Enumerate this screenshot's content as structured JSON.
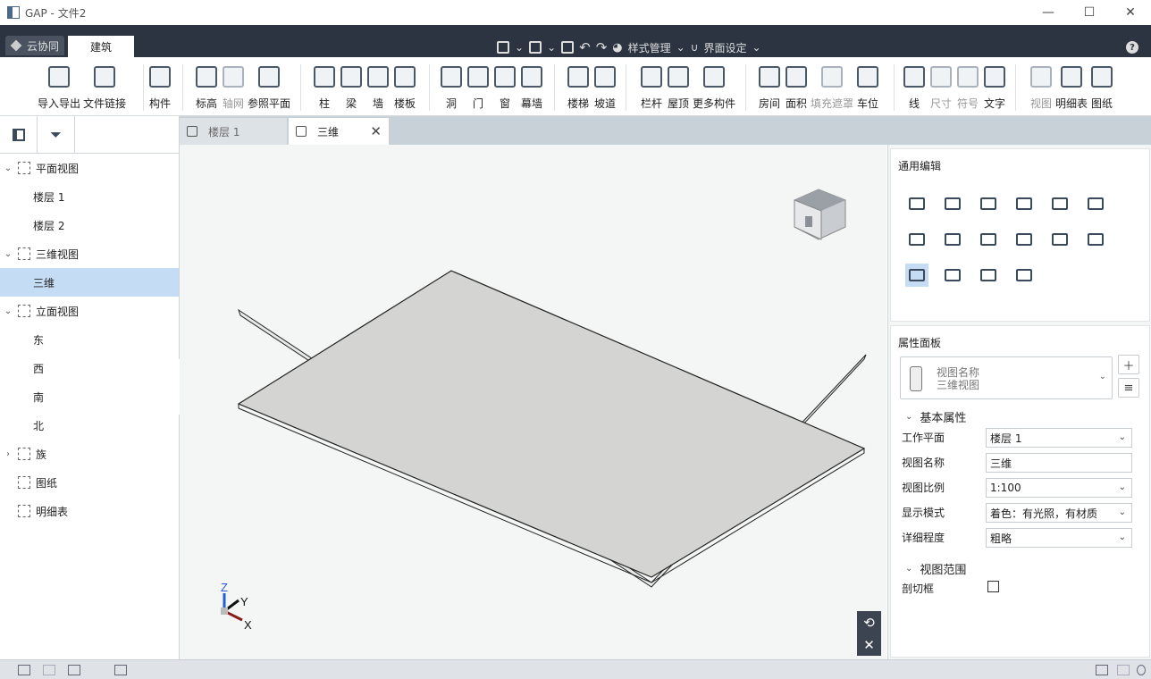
{
  "window": {
    "title": "GAP - 文件2",
    "minimize": "—",
    "maximize": "☐",
    "close": "✕"
  },
  "tabs": {
    "cloud": "云协同",
    "build": "建筑"
  },
  "quickbar": {
    "style_manage": "样式管理",
    "ui_settings": "界面设定",
    "help": "?"
  },
  "ribbon": [
    {
      "label": "导入导出",
      "icon": "cad-import-icon",
      "enabled": true
    },
    {
      "label": "文件链接",
      "icon": "file-link-icon",
      "enabled": true
    },
    {
      "label": "构件",
      "icon": "component-icon",
      "enabled": true
    },
    {
      "label": "标高",
      "icon": "level-icon",
      "enabled": true
    },
    {
      "label": "轴网",
      "icon": "grid-icon",
      "enabled": false
    },
    {
      "label": "参照平面",
      "icon": "ref-plane-icon",
      "enabled": true
    },
    {
      "label": "柱",
      "icon": "column-icon",
      "enabled": true
    },
    {
      "label": "梁",
      "icon": "beam-icon",
      "enabled": true
    },
    {
      "label": "墙",
      "icon": "wall-icon",
      "enabled": true
    },
    {
      "label": "楼板",
      "icon": "slab-icon",
      "enabled": true
    },
    {
      "label": "洞",
      "icon": "opening-icon",
      "enabled": true
    },
    {
      "label": "门",
      "icon": "door-icon",
      "enabled": true
    },
    {
      "label": "窗",
      "icon": "window-icon",
      "enabled": true
    },
    {
      "label": "幕墙",
      "icon": "curtain-wall-icon",
      "enabled": true
    },
    {
      "label": "楼梯",
      "icon": "stair-icon",
      "enabled": true
    },
    {
      "label": "坡道",
      "icon": "ramp-icon",
      "enabled": true
    },
    {
      "label": "栏杆",
      "icon": "railing-icon",
      "enabled": true
    },
    {
      "label": "屋顶",
      "icon": "roof-icon",
      "enabled": true
    },
    {
      "label": "更多构件",
      "icon": "more-components-icon",
      "enabled": true
    },
    {
      "label": "房间",
      "icon": "room-icon",
      "enabled": true
    },
    {
      "label": "面积",
      "icon": "area-icon",
      "enabled": true
    },
    {
      "label": "填充遮罩",
      "icon": "fill-mask-icon",
      "enabled": false
    },
    {
      "label": "车位",
      "icon": "parking-icon",
      "enabled": true
    },
    {
      "label": "线",
      "icon": "line-icon",
      "enabled": true
    },
    {
      "label": "尺寸",
      "icon": "dimension-icon",
      "enabled": false
    },
    {
      "label": "符号",
      "icon": "symbol-icon",
      "enabled": false
    },
    {
      "label": "文字",
      "icon": "text-icon",
      "enabled": true
    },
    {
      "label": "视图",
      "icon": "view-icon",
      "enabled": false
    },
    {
      "label": "明细表",
      "icon": "schedule-icon",
      "enabled": true
    },
    {
      "label": "图纸",
      "icon": "sheet-icon",
      "enabled": true
    }
  ],
  "tree": [
    {
      "label": "平面视图",
      "expanded": true
    },
    {
      "label": "楼层 1"
    },
    {
      "label": "楼层 2"
    },
    {
      "label": "三维视图",
      "expanded": true
    },
    {
      "label": "三维",
      "selected": true
    },
    {
      "label": "立面视图",
      "expanded": true
    },
    {
      "label": "东"
    },
    {
      "label": "西"
    },
    {
      "label": "南"
    },
    {
      "label": "北"
    },
    {
      "label": "族",
      "expanded": false
    },
    {
      "label": "图纸"
    },
    {
      "label": "明细表"
    }
  ],
  "doctabs": [
    {
      "label": "楼层 1"
    },
    {
      "label": "三维",
      "active": true
    }
  ],
  "axes": {
    "z": "Z",
    "y": "Y",
    "x": "X"
  },
  "general_edit": {
    "title": "通用编辑"
  },
  "properties": {
    "title": "属性面板",
    "type_name_label": "视图名称",
    "type_name_value": "三维视图",
    "basic_section": "基本属性",
    "rows": [
      {
        "label": "工作平面",
        "value": "楼层 1",
        "dropdown": true
      },
      {
        "label": "视图名称",
        "value": "三维",
        "dropdown": false
      },
      {
        "label": "视图比例",
        "value": "1:100",
        "dropdown": true
      },
      {
        "label": "显示模式",
        "value": "着色：有光照，有材质",
        "dropdown": true
      },
      {
        "label": "详细程度",
        "value": "粗略",
        "dropdown": true
      }
    ],
    "range_section": "视图范围",
    "crop_label": "剖切框",
    "crop_checked": false
  }
}
